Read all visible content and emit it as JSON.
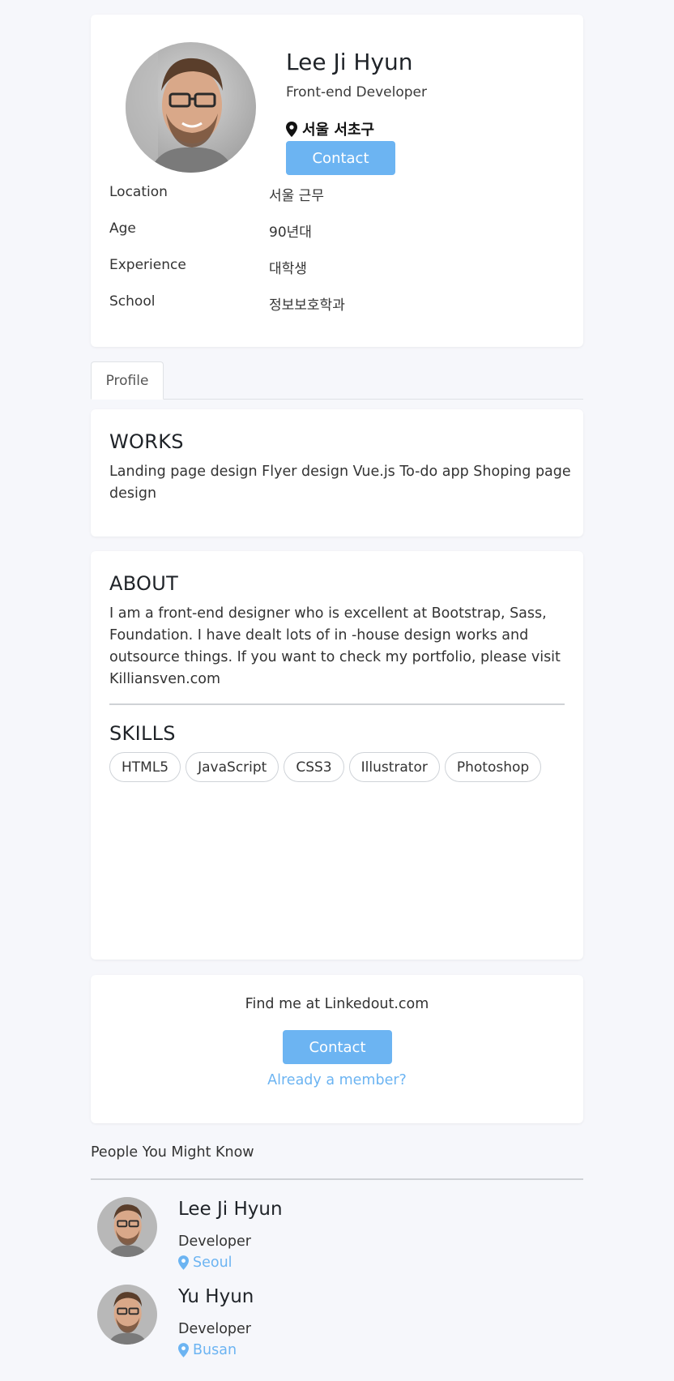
{
  "profile": {
    "name": "Lee Ji Hyun",
    "role": "Front-end Developer",
    "location": "서울 서초구",
    "contact_label": "Contact",
    "info": [
      {
        "key": "Location",
        "value": "서울 근무"
      },
      {
        "key": "Age",
        "value": "90년대"
      },
      {
        "key": "Experience",
        "value": "대학생"
      },
      {
        "key": "School",
        "value": "정보보호학과"
      }
    ]
  },
  "tabs": [
    {
      "label": "Profile"
    }
  ],
  "works": {
    "title": "WORKS",
    "text": "Landing page design Flyer design Vue.js To-do app Shoping page design"
  },
  "about": {
    "title": "ABOUT",
    "text": "I am a front-end designer who is excellent at Bootstrap, Sass, Foundation. I have dealt lots of in -house design works and outsource things. If you want to check my portfolio, please visit Killiansven.com",
    "skills_title": "SKILLS",
    "skills": [
      "HTML5",
      "JavaScript",
      "CSS3",
      "Illustrator",
      "Photoshop"
    ]
  },
  "contact": {
    "find_text": "Find me at Linkedout.com",
    "button_label": "Contact",
    "member_link": "Already a member?"
  },
  "people": {
    "heading": "People You Might Know",
    "list": [
      {
        "name": "Lee Ji Hyun",
        "role": "Developer",
        "location": "Seoul"
      },
      {
        "name": "Yu Hyun",
        "role": "Developer",
        "location": "Busan"
      }
    ]
  },
  "colors": {
    "accent": "#6cb4f2",
    "background": "#f6f7fb",
    "card": "#ffffff"
  }
}
